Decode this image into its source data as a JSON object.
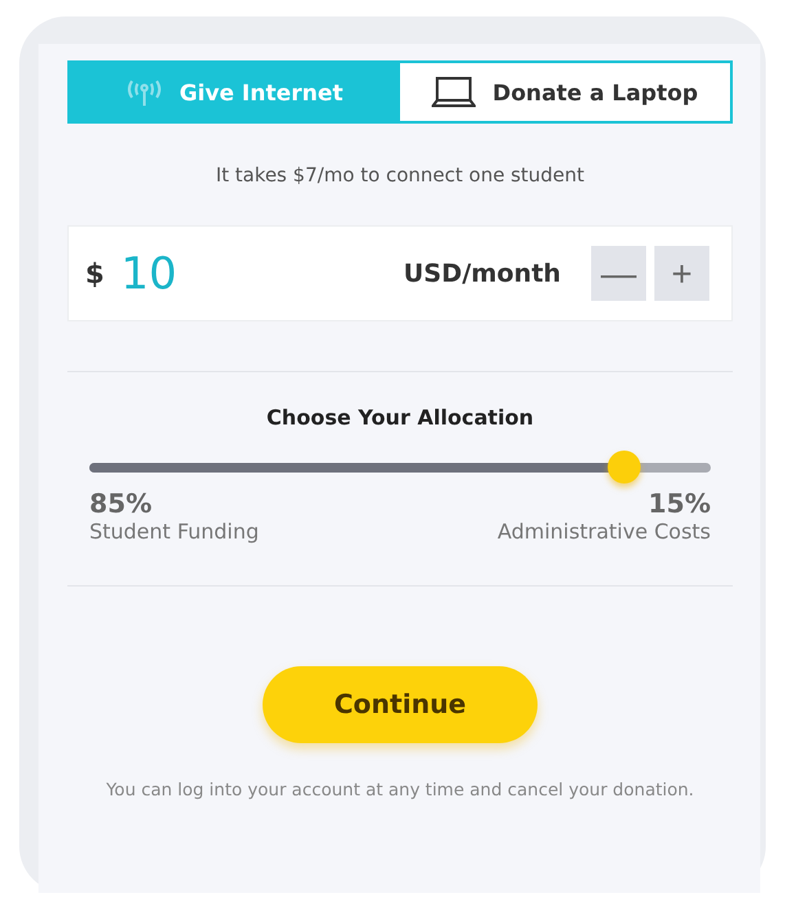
{
  "tabs": [
    {
      "label": "Give Internet",
      "selected": true
    },
    {
      "label": "Donate a Laptop",
      "selected": false
    }
  ],
  "tagline": "It takes $7/mo to connect one student",
  "amount": {
    "currency_symbol": "$",
    "value": "10",
    "unit": "USD/month",
    "decrement": "—",
    "increment": "+"
  },
  "allocation": {
    "title": "Choose Your Allocation",
    "level": 0.86,
    "left": {
      "percent": "85%",
      "label": "Student Funding"
    },
    "right": {
      "percent": "15%",
      "label": "Administrative Costs"
    }
  },
  "continue_button": "Continue",
  "footnote": "You can log into your account at any time and cancel your donation."
}
